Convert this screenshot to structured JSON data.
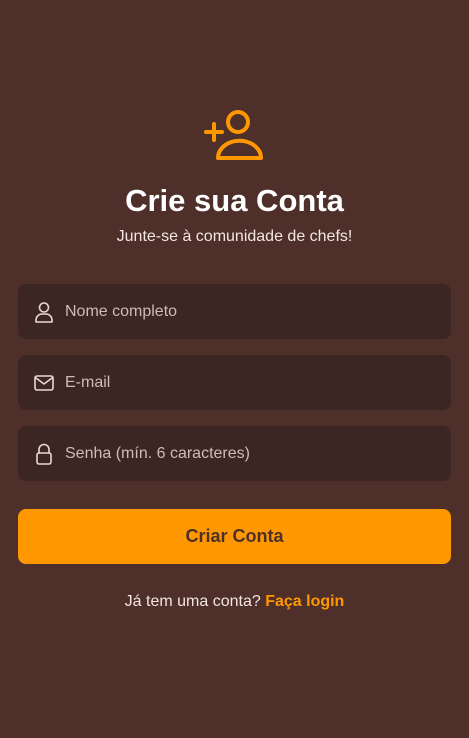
{
  "header": {
    "icon": "add-user-icon",
    "title": "Crie sua Conta",
    "subtitle": "Junte-se à comunidade de chefs!"
  },
  "form": {
    "name_field": {
      "icon": "user-icon",
      "placeholder": "Nome completo",
      "value": ""
    },
    "email_field": {
      "icon": "mail-icon",
      "placeholder": "E-mail",
      "value": ""
    },
    "password_field": {
      "icon": "lock-icon",
      "placeholder": "Senha (mín. 6 caracteres)",
      "value": ""
    },
    "submit_label": "Criar Conta"
  },
  "footer": {
    "prompt": "Já tem uma conta?",
    "login_link": "Faça login"
  },
  "colors": {
    "background": "#4e2f2a",
    "field_background": "#3b2624",
    "accent": "#ff9800",
    "text": "#ffffff"
  }
}
